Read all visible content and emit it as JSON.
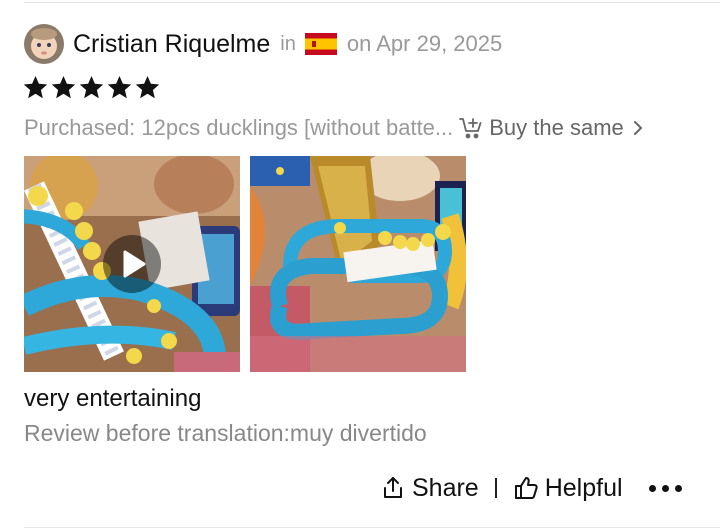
{
  "review": {
    "author": "Cristian Riquelme",
    "in_label": "in",
    "date": "on Apr 29, 2025",
    "rating": 5,
    "purchased": "Purchased: 12pcs ducklings [without batte...",
    "buy_label": "Buy the same",
    "text": "very entertaining",
    "original": "Review before translation:muy divertido"
  },
  "actions": {
    "share_label": "Share",
    "helpful_label": "Helpful"
  },
  "colors": {
    "muted": "#999999",
    "track_blue": "#2ea8d8",
    "duck_yellow": "#f2d84a",
    "star": "#111111"
  },
  "icons": [
    "flag-spain-icon",
    "star-icon",
    "cart-plus-icon",
    "chevron-right-icon",
    "play-icon",
    "share-icon",
    "thumbs-up-icon",
    "more-icon"
  ]
}
